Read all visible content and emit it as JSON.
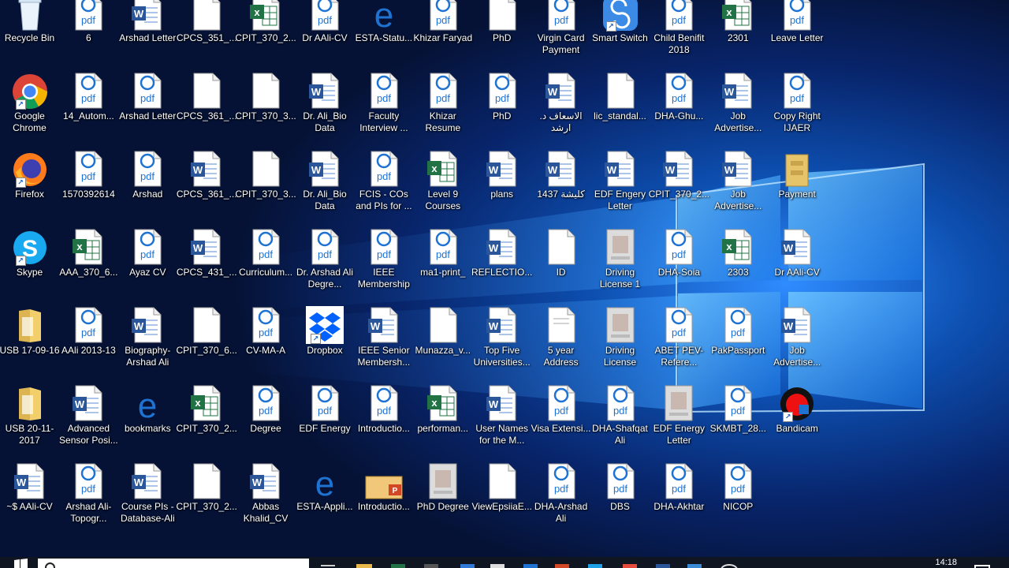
{
  "desktop": {
    "icons": [
      {
        "label": "Recycle Bin",
        "type": "recycle",
        "col": 0,
        "row": 0
      },
      {
        "label": "6",
        "type": "pdf",
        "col": 1,
        "row": 0
      },
      {
        "label": "Arshad Letter",
        "type": "word",
        "col": 2,
        "row": 0
      },
      {
        "label": "CPCS_351_...",
        "type": "blank",
        "col": 3,
        "row": 0
      },
      {
        "label": "CPIT_370_2...",
        "type": "excel",
        "col": 4,
        "row": 0
      },
      {
        "label": "Dr AAli-CV",
        "type": "pdf",
        "col": 5,
        "row": 0
      },
      {
        "label": "ESTA-Statu...",
        "type": "edge",
        "col": 6,
        "row": 0
      },
      {
        "label": "Khizar Faryad",
        "type": "pdf",
        "col": 7,
        "row": 0
      },
      {
        "label": "PhD",
        "type": "blank",
        "col": 8,
        "row": 0
      },
      {
        "label": "Virgin Card Payment",
        "type": "pdf",
        "col": 9,
        "row": 0
      },
      {
        "label": "Smart Switch",
        "type": "smartswitch",
        "col": 10,
        "row": 0
      },
      {
        "label": "Child Benifit 2018",
        "type": "pdf",
        "col": 11,
        "row": 0
      },
      {
        "label": "2301",
        "type": "excel",
        "col": 12,
        "row": 0
      },
      {
        "label": "Leave Letter",
        "type": "pdf",
        "col": 13,
        "row": 0
      },
      {
        "label": "Google Chrome",
        "type": "chrome",
        "col": 0,
        "row": 1
      },
      {
        "label": "14_Autom...",
        "type": "pdf",
        "col": 1,
        "row": 1
      },
      {
        "label": "Arshad Letter",
        "type": "pdf",
        "col": 2,
        "row": 1
      },
      {
        "label": "CPCS_361_...",
        "type": "blank",
        "col": 3,
        "row": 1
      },
      {
        "label": "CPIT_370_3...",
        "type": "blank",
        "col": 4,
        "row": 1
      },
      {
        "label": "Dr. Ali_Bio Data",
        "type": "word",
        "col": 5,
        "row": 1
      },
      {
        "label": "Faculty Interview ...",
        "type": "pdf",
        "col": 6,
        "row": 1
      },
      {
        "label": "Khizar Resume",
        "type": "pdf",
        "col": 7,
        "row": 1
      },
      {
        "label": "PhD",
        "type": "pdf",
        "col": 8,
        "row": 1
      },
      {
        "label": "الاسعاف د. ارشد",
        "type": "word",
        "col": 9,
        "row": 1
      },
      {
        "label": "lic_standal...",
        "type": "blank",
        "col": 10,
        "row": 1
      },
      {
        "label": "DHA-Ghu...",
        "type": "pdf",
        "col": 11,
        "row": 1
      },
      {
        "label": "Job Advertise...",
        "type": "word",
        "col": 12,
        "row": 1
      },
      {
        "label": "Copy Right IJAER",
        "type": "pdf",
        "col": 13,
        "row": 1
      },
      {
        "label": "Firefox",
        "type": "firefox",
        "col": 0,
        "row": 2
      },
      {
        "label": "1570392614",
        "type": "pdf",
        "col": 1,
        "row": 2
      },
      {
        "label": "Arshad",
        "type": "pdf",
        "col": 2,
        "row": 2
      },
      {
        "label": "CPCS_361_...",
        "type": "word",
        "col": 3,
        "row": 2
      },
      {
        "label": "CPIT_370_3...",
        "type": "blank",
        "col": 4,
        "row": 2
      },
      {
        "label": "Dr. Ali_Bio Data",
        "type": "word",
        "col": 5,
        "row": 2
      },
      {
        "label": "FCIS - COs and PIs for ...",
        "type": "pdf",
        "col": 6,
        "row": 2
      },
      {
        "label": "Level 9 Courses",
        "type": "excel",
        "col": 7,
        "row": 2
      },
      {
        "label": "plans",
        "type": "word",
        "col": 8,
        "row": 2
      },
      {
        "label": "1437 كليشة",
        "type": "word",
        "col": 9,
        "row": 2
      },
      {
        "label": "EDF Engery Letter",
        "type": "word",
        "col": 10,
        "row": 2
      },
      {
        "label": "CPIT_370_2...",
        "type": "word",
        "col": 11,
        "row": 2
      },
      {
        "label": "Job Advertise...",
        "type": "word",
        "col": 12,
        "row": 2
      },
      {
        "label": "Payment",
        "type": "cabinet",
        "col": 13,
        "row": 2
      },
      {
        "label": "Skype",
        "type": "skype",
        "col": 0,
        "row": 3
      },
      {
        "label": "AAA_370_6...",
        "type": "excel",
        "col": 1,
        "row": 3
      },
      {
        "label": "Ayaz CV",
        "type": "pdf",
        "col": 2,
        "row": 3
      },
      {
        "label": "CPCS_431_...",
        "type": "word",
        "col": 3,
        "row": 3
      },
      {
        "label": "Curriculum...",
        "type": "pdf",
        "col": 4,
        "row": 3
      },
      {
        "label": "Dr. Arshad Ali Degre...",
        "type": "pdf",
        "col": 5,
        "row": 3
      },
      {
        "label": "IEEE Membership",
        "type": "pdf",
        "col": 6,
        "row": 3
      },
      {
        "label": "ma1-print_",
        "type": "pdf",
        "col": 7,
        "row": 3
      },
      {
        "label": "REFLECTIO...",
        "type": "word",
        "col": 8,
        "row": 3
      },
      {
        "label": "ID",
        "type": "blank",
        "col": 9,
        "row": 3
      },
      {
        "label": "Driving License 1",
        "type": "image",
        "col": 10,
        "row": 3
      },
      {
        "label": "DHA-Soia",
        "type": "pdf",
        "col": 11,
        "row": 3
      },
      {
        "label": "2303",
        "type": "excel",
        "col": 12,
        "row": 3
      },
      {
        "label": "Dr AAli-CV",
        "type": "word",
        "col": 13,
        "row": 3
      },
      {
        "label": "USB 17-09-16",
        "type": "folder",
        "col": 0,
        "row": 4
      },
      {
        "label": "AAli 2013-13",
        "type": "pdf",
        "col": 1,
        "row": 4
      },
      {
        "label": "Biography-Arshad Ali",
        "type": "word",
        "col": 2,
        "row": 4
      },
      {
        "label": "CPIT_370_6...",
        "type": "blank",
        "col": 3,
        "row": 4
      },
      {
        "label": "CV-MA-A",
        "type": "pdf",
        "col": 4,
        "row": 4
      },
      {
        "label": "Dropbox",
        "type": "dropbox",
        "col": 5,
        "row": 4
      },
      {
        "label": "IEEE Senior Membersh...",
        "type": "word",
        "col": 6,
        "row": 4
      },
      {
        "label": "Munazza_v...",
        "type": "blank",
        "col": 7,
        "row": 4
      },
      {
        "label": "Top Five Universities...",
        "type": "word",
        "col": 8,
        "row": 4
      },
      {
        "label": "5 year Address",
        "type": "doc",
        "col": 9,
        "row": 4
      },
      {
        "label": "Driving License",
        "type": "image",
        "col": 10,
        "row": 4
      },
      {
        "label": "ABET PEV-Refere...",
        "type": "pdf",
        "col": 11,
        "row": 4
      },
      {
        "label": "PakPassport",
        "type": "pdf",
        "col": 12,
        "row": 4
      },
      {
        "label": "Job Advertise...",
        "type": "word",
        "col": 13,
        "row": 4
      },
      {
        "label": "USB 20-11-2017",
        "type": "folder",
        "col": 0,
        "row": 5
      },
      {
        "label": "Advanced Sensor Posi...",
        "type": "word",
        "col": 1,
        "row": 5
      },
      {
        "label": "bookmarks",
        "type": "edge",
        "col": 2,
        "row": 5
      },
      {
        "label": "CPIT_370_2...",
        "type": "excel",
        "col": 3,
        "row": 5
      },
      {
        "label": "Degree",
        "type": "pdf",
        "col": 4,
        "row": 5
      },
      {
        "label": "EDF Energy",
        "type": "pdf",
        "col": 5,
        "row": 5
      },
      {
        "label": "Introductio...",
        "type": "pdf",
        "col": 6,
        "row": 5
      },
      {
        "label": "performan...",
        "type": "excel",
        "col": 7,
        "row": 5
      },
      {
        "label": "User Names for the M...",
        "type": "word",
        "col": 8,
        "row": 5
      },
      {
        "label": "Visa Extensi...",
        "type": "pdf",
        "col": 9,
        "row": 5
      },
      {
        "label": "DHA-Shafqat Ali",
        "type": "pdf",
        "col": 10,
        "row": 5
      },
      {
        "label": "EDF Energy Letter",
        "type": "image",
        "col": 11,
        "row": 5
      },
      {
        "label": "SKMBT_28...",
        "type": "pdf",
        "col": 12,
        "row": 5
      },
      {
        "label": "Bandicam",
        "type": "bandicam",
        "col": 13,
        "row": 5
      },
      {
        "label": "~$ AAli-CV",
        "type": "word",
        "col": 0,
        "row": 6
      },
      {
        "label": "Arshad Ali-Topogr...",
        "type": "pdf",
        "col": 1,
        "row": 6
      },
      {
        "label": "Course PIs - Database-Ali",
        "type": "word",
        "col": 2,
        "row": 6
      },
      {
        "label": "CPIT_370_2...",
        "type": "blank",
        "col": 3,
        "row": 6
      },
      {
        "label": "Abbas Khalid_CV",
        "type": "word",
        "col": 4,
        "row": 6
      },
      {
        "label": "ESTA-Appli...",
        "type": "edge",
        "col": 5,
        "row": 6
      },
      {
        "label": "Introductio...",
        "type": "ppt",
        "col": 6,
        "row": 6
      },
      {
        "label": "PhD Degree",
        "type": "image",
        "col": 7,
        "row": 6
      },
      {
        "label": "ViewEpsiiaE...",
        "type": "blank",
        "col": 8,
        "row": 6
      },
      {
        "label": "DHA-Arshad Ali",
        "type": "pdf",
        "col": 9,
        "row": 6
      },
      {
        "label": "DBS",
        "type": "pdf",
        "col": 10,
        "row": 6
      },
      {
        "label": "DHA-Akhtar",
        "type": "pdf",
        "col": 11,
        "row": 6
      },
      {
        "label": "NICOP",
        "type": "pdf",
        "col": 12,
        "row": 6
      }
    ]
  },
  "taskbar": {
    "clock_time": "14:18"
  },
  "icon_text": {
    "pdf": "pdf",
    "excel": "x",
    "word": "W",
    "edge": "e"
  },
  "colors": {
    "pdf_blue": "#1e73d2",
    "word_blue": "#2b579a",
    "excel_green": "#217346",
    "wallpaper_dark": "#06142f",
    "wallpaper_glow": "#2aa0ff"
  }
}
